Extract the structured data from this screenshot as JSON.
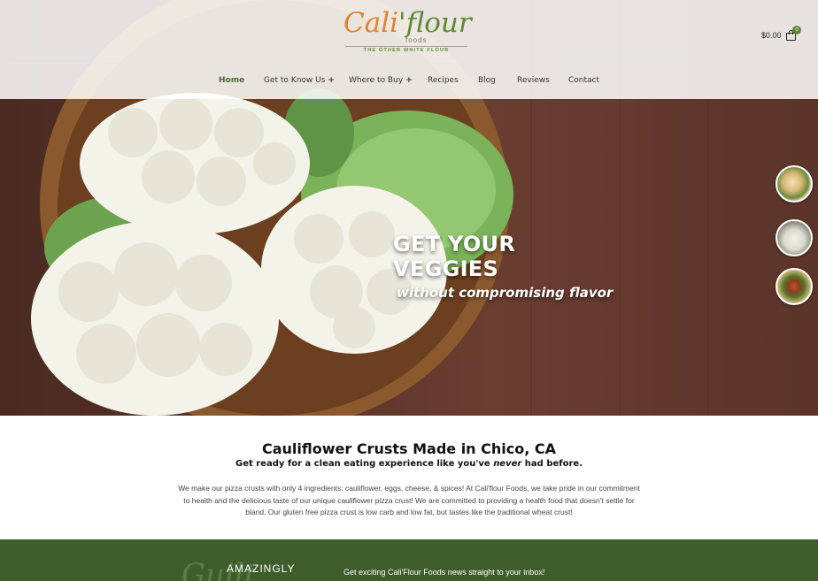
{
  "header": {
    "logo": {
      "brand_part1": "Cali",
      "brand_part2": "flour",
      "sub": "foods",
      "tagline": "THE OTHER WHITE FLOUR"
    },
    "cart": {
      "total": "$0.00",
      "count": "0",
      "icon": "shopping-bag-icon"
    },
    "nav": [
      {
        "label": "Home",
        "active": true
      },
      {
        "label": "Get to Know Us",
        "has_submenu": true
      },
      {
        "label": "Where to Buy",
        "has_submenu": true
      },
      {
        "label": "Recipes"
      },
      {
        "label": "Blog"
      },
      {
        "label": "Reviews"
      },
      {
        "label": "Contact"
      }
    ],
    "submenu_glyph": "+"
  },
  "hero": {
    "title": "GET YOUR VEGGIES",
    "subtitle": "without compromising flavor"
  },
  "intro": {
    "title": "Cauliflower Crusts Made in Chico, CA",
    "sub_before": "Get ready for a clean eating experience like you've ",
    "sub_em": "never",
    "sub_after": " had before.",
    "body": "We make our pizza crusts with only 4 ingredients: cauliflower, eggs, cheese, & spices! At Cali'flour Foods, we take pride in our commitment to health and the delicious taste of our unique cauliflower pizza crust! We are committed to providing a health food that doesn't settle for bland. Our gluten free pizza crust is low carb and low fat, but tastes like the traditional wheat crust!"
  },
  "newsletter": {
    "heading": "AMAZINGLY",
    "script_word": "Guilt",
    "text": "Get exciting Cali'Flour Foods news straight to your inbox!"
  },
  "colors": {
    "accent_green": "#4a6b2a",
    "band_green": "#3e5d2a",
    "logo_orange": "#e0822b"
  }
}
